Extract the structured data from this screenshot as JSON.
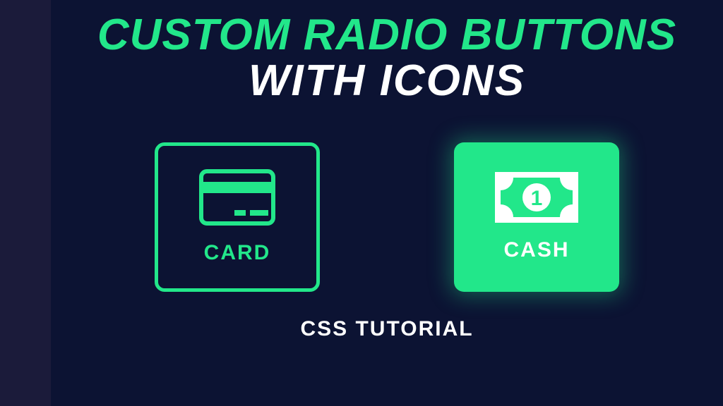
{
  "heading": {
    "line1": "CUSTOM RADIO BUTTONS",
    "line2": "WITH ICONS"
  },
  "options": {
    "card": {
      "label": "CARD",
      "selected": false
    },
    "cash": {
      "label": "CASH",
      "selected": true
    }
  },
  "footer": "CSS TUTORIAL",
  "colors": {
    "accent": "#22e78a",
    "bg": "#0c1333",
    "sidebar": "#1b1b3a"
  }
}
